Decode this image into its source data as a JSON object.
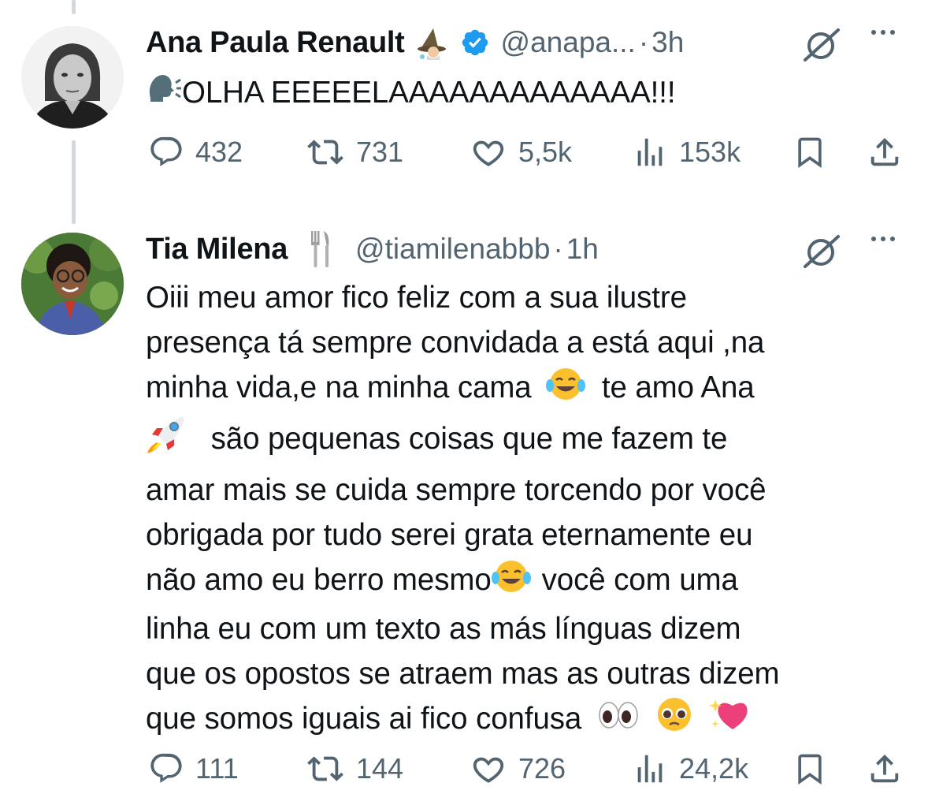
{
  "tweets": [
    {
      "display_name": "Ana Paula Renault",
      "name_emoji_icon": "mage-emoji-icon",
      "verified": true,
      "handle": "@anapa...",
      "separator": "·",
      "time": "3h",
      "text_lines": [
        "OLHA EEEEELAAAAAAAAAAAAA!!!"
      ],
      "leading_icon": "speaking-head-emoji-icon",
      "stats": {
        "replies": "432",
        "retweets": "731",
        "likes": "5,5k",
        "views": "153k"
      }
    },
    {
      "display_name": "Tia Milena",
      "name_emoji_icon": "fork-and-knife-emoji-icon",
      "verified": false,
      "handle": "@tiamilenabbb",
      "separator": "·",
      "time": "1h",
      "text_lines": [
        "Oiii meu amor fico feliz com a sua ilustre",
        "presença tá sempre convidada a está aqui ,na",
        "minha vida,e na minha cama",
        "te amo Ana",
        "são pequenas coisas que me fazem te",
        "amar mais se cuida sempre torcendo por você",
        "obrigada por tudo serei grata eternamente eu",
        "não amo eu berro mesmo",
        "você com uma",
        "linha eu com um texto as más línguas dizem",
        "que os opostos se atraem mas as outras dizem",
        "que somos iguais ai fico confusa"
      ],
      "stats": {
        "replies": "111",
        "retweets": "144",
        "likes": "726",
        "views": "24,2k"
      }
    }
  ],
  "colors": {
    "text": "#0f1419",
    "secondary": "#536471",
    "verified_blue": "#1d9bf0",
    "thread_line": "#cfd9de"
  }
}
